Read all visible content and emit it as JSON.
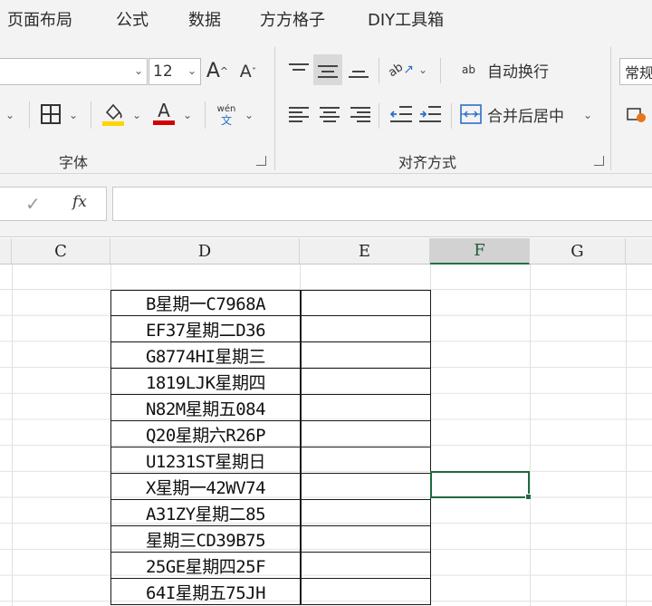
{
  "menu": {
    "tabs": [
      "页面布局",
      "公式",
      "数据",
      "方方格子",
      "DIY工具箱"
    ]
  },
  "ribbon": {
    "font_size": "12",
    "grow_font": "A",
    "shrink_font": "A",
    "font_color_letter": "A",
    "phonetic_top": "wén",
    "phonetic_bottom": "文",
    "font_group_label": "字体",
    "wrap_text_label": "自动换行",
    "merge_center_label": "合并后居中",
    "orientation_label": "ab",
    "wrap_icon_text": "ab",
    "align_group_label": "对齐方式",
    "number_format_value": "常规",
    "fill_color": "#ffd400",
    "font_color": "#d40000"
  },
  "formula_bar": {
    "check_symbol": "✓",
    "fx_label": "fx",
    "value": ""
  },
  "grid": {
    "columns": [
      "C",
      "D",
      "E",
      "F",
      "G"
    ],
    "selected_column": "F",
    "cells": [
      "B星期一C7968A",
      "EF37星期二D36",
      "G8774HI星期三",
      "1819LJK星期四",
      "N82M星期五084",
      "Q20星期六R26P",
      "U1231ST星期日",
      "X星期一42WV74",
      "A31ZY星期二85",
      "星期三CD39B75",
      "25GE星期四25F",
      "64I星期五75JH"
    ],
    "accent_color": "#217346"
  }
}
